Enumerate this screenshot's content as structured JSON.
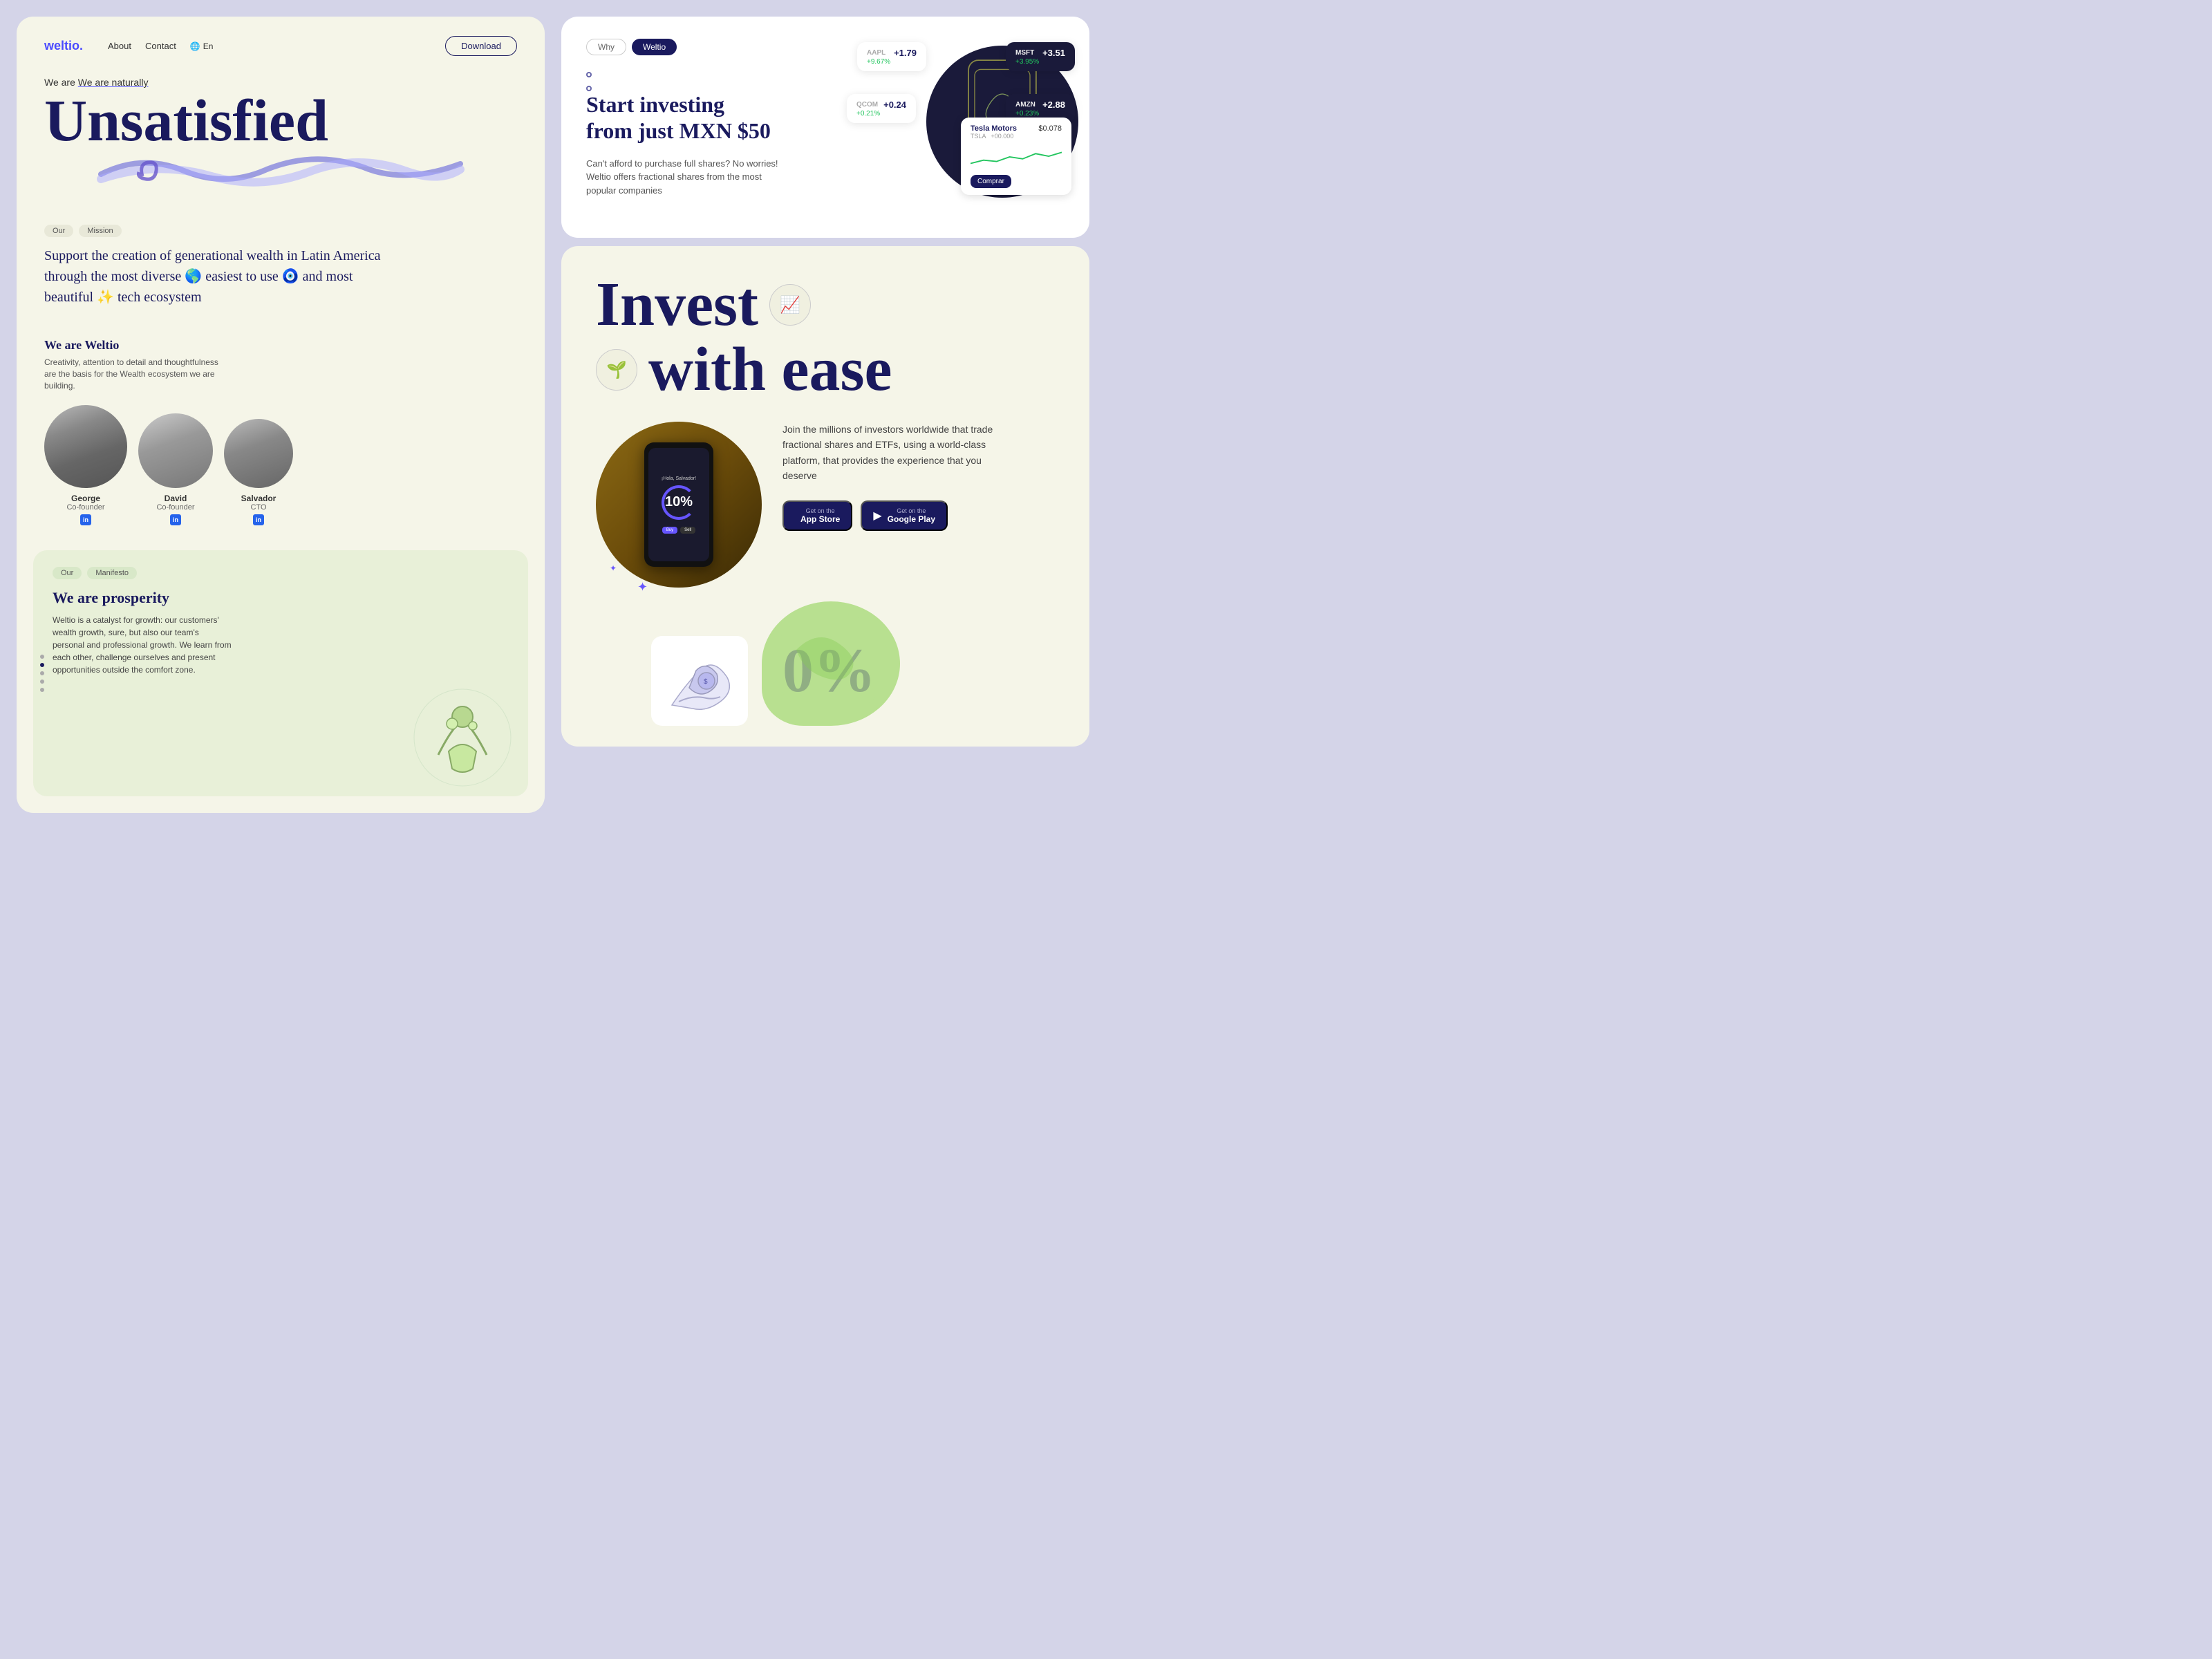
{
  "brand": {
    "name": "weltio.",
    "dot_color": "#4a4aff"
  },
  "nav": {
    "about": "About",
    "contact": "Contact",
    "lang": "En",
    "download": "Download"
  },
  "hero": {
    "subtitle": "We are naturally",
    "title": "Unsatisfied"
  },
  "mission": {
    "breadcrumb1": "Our",
    "breadcrumb2": "Mission",
    "text": "Support the creation of generational wealth in Latin America through the most diverse 🌎 easiest to use 🧿 and most beautiful ✨ tech ecosystem"
  },
  "team": {
    "title": "We are Weltio",
    "desc": "Creativity, attention to detail and thoughtfulness are the basis for the Wealth ecosystem we are building.",
    "members": [
      {
        "name": "George",
        "role": "Co-founder"
      },
      {
        "name": "David",
        "role": "Co-founder"
      },
      {
        "name": "Salvador",
        "role": "CTO"
      }
    ]
  },
  "manifesto": {
    "breadcrumb1": "Our",
    "breadcrumb2": "Manifesto",
    "title": "We are prosperity",
    "desc": "Weltio is a catalyst for growth: our customers' wealth growth, sure, but also our team's personal and professional growth. We learn from each other, challenge ourselves and present opportunities outside the comfort zone."
  },
  "investing": {
    "tab1": "Why",
    "tab2": "Weltio",
    "title": "Start investing\nfrom just MXN $50",
    "desc": "Can't afford to purchase full shares? No worries! Weltio offers fractional shares from the most popular companies",
    "stocks": [
      {
        "sym": "AAPL",
        "price": "+1.79",
        "change": "+9.67%"
      },
      {
        "sym": "MSFT",
        "price": "+3.51",
        "change": "+3.95%"
      },
      {
        "sym": "QCOM",
        "price": "+0.24",
        "change": "+0.21%"
      },
      {
        "sym": "AMZN",
        "price": "+2.88",
        "change": "+0.23%"
      }
    ],
    "tesla": {
      "name": "Tesla Motors",
      "ticker": "TSLA",
      "sub": "+00.000",
      "price": "$0.078",
      "buy_btn": "Comprar"
    }
  },
  "invest": {
    "title_line1": "Invest",
    "title_line2": "with ease",
    "desc": "Join the millions of investors worldwide that trade fractional shares and ETFs, using a world-class platform, that provides the experience that you deserve",
    "app_store": "Get on the\nApp Store",
    "google_play": "Get on the\nGoogle Play",
    "phone_greeting": "¡Hola, Salvador!",
    "phone_percent": "10%"
  }
}
